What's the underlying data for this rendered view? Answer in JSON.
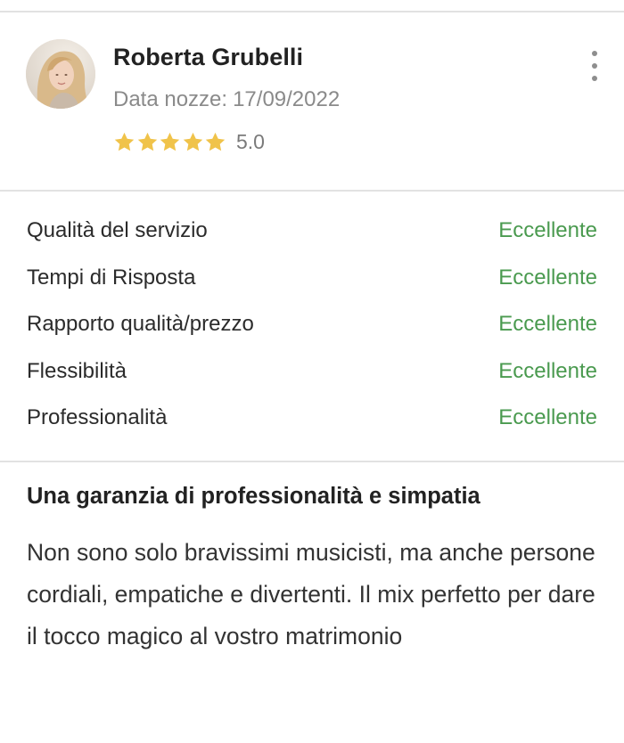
{
  "review": {
    "reviewer_name": "Roberta Grubelli",
    "wedding_date_label": "Data nozze:",
    "wedding_date_value": "17/09/2022",
    "stars": 5,
    "rating_value": "5.0",
    "star_color": "#f0c34a",
    "menu_icon": "more-vertical-icon"
  },
  "ratings": [
    {
      "label": "Qualità del servizio",
      "grade": "Eccellente"
    },
    {
      "label": "Tempi di Risposta",
      "grade": "Eccellente"
    },
    {
      "label": "Rapporto qualità/prezzo",
      "grade": "Eccellente"
    },
    {
      "label": "Flessibilità",
      "grade": "Eccellente"
    },
    {
      "label": "Professionalità",
      "grade": "Eccellente"
    }
  ],
  "grade_color": "#4a9a4f",
  "review_text": {
    "title": "Una garanzia di professionalità e simpatia",
    "body": "Non sono solo bravissimi musicisti, ma anche persone cordiali, empatiche e divertenti. Il mix perfetto per dare il tocco magico al vostro matrimonio"
  }
}
